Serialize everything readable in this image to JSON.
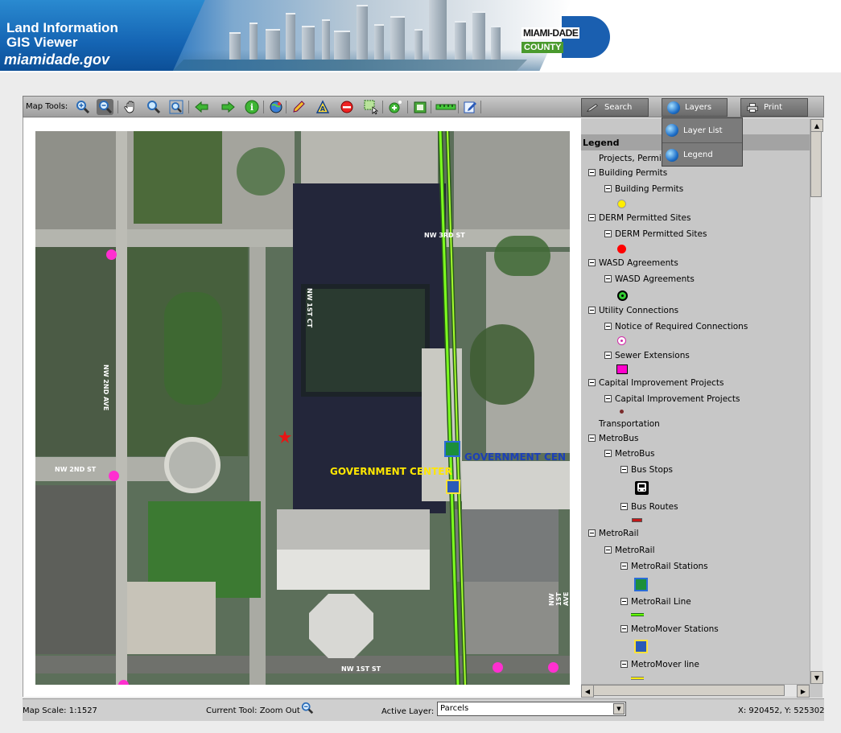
{
  "banner": {
    "title_line1": "Land Information",
    "title_line2": "GIS Viewer",
    "url": "miamidade.gov",
    "logo_name": "MIAMI-DADE",
    "logo_sub": "COUNTY"
  },
  "toolbar": {
    "label": "Map Tools:",
    "tools": [
      "zoom-in-icon",
      "zoom-out-icon",
      "pan-hand-icon",
      "zoom-full-icon",
      "zoom-extent-icon",
      "back-icon",
      "forward-icon",
      "identify-icon",
      "globe-icon",
      "pencil-icon",
      "text-icon",
      "erase-icon",
      "select-box-icon",
      "add-point-icon",
      "clear-icon",
      "measure-icon",
      "edit-icon"
    ],
    "active_tool": "zoom-out-icon"
  },
  "tabs": {
    "search": "Search",
    "layers": "Layers",
    "print": "Print"
  },
  "layers_menu": {
    "items": [
      "Layer List",
      "Legend"
    ]
  },
  "map": {
    "labels": {
      "street_3rd": "NW 3RD ST",
      "street_1st_ct": "NW 1ST CT",
      "ave_2nd": "NW 2ND AVE",
      "street_2nd": "NW 2ND ST",
      "gov_center": "GOVERNMENT CENTER",
      "gov_center_2": "GOVERNMENT CEN",
      "street_1st": "NW 1ST ST",
      "ave_1st": "NW 1ST AVE"
    }
  },
  "legend": {
    "header": "Legend",
    "rows": [
      {
        "text": "Projects, Permits",
        "indent": 0,
        "toggle": false
      },
      {
        "text": "Building Permits",
        "indent": 0,
        "toggle": true
      },
      {
        "text": "Building Permits",
        "indent": 1,
        "toggle": true
      },
      {
        "text": "DERM Permitted Sites",
        "indent": 0,
        "toggle": true
      },
      {
        "text": "DERM Permitted Sites",
        "indent": 1,
        "toggle": true
      },
      {
        "text": "WASD Agreements",
        "indent": 0,
        "toggle": true
      },
      {
        "text": "WASD Agreements",
        "indent": 1,
        "toggle": true
      },
      {
        "text": "Utility Connections",
        "indent": 0,
        "toggle": true
      },
      {
        "text": "Notice of Required Connections",
        "indent": 1,
        "toggle": true
      },
      {
        "text": "Sewer Extensions",
        "indent": 1,
        "toggle": true
      },
      {
        "text": "Capital Improvement Projects",
        "indent": 0,
        "toggle": true
      },
      {
        "text": "Capital Improvement Projects",
        "indent": 1,
        "toggle": true
      },
      {
        "text": "Transportation",
        "indent": 0,
        "toggle": false
      },
      {
        "text": "MetroBus",
        "indent": 0,
        "toggle": true
      },
      {
        "text": "MetroBus",
        "indent": 1,
        "toggle": true
      },
      {
        "text": "Bus Stops",
        "indent": 2,
        "toggle": true
      },
      {
        "text": "Bus Routes",
        "indent": 2,
        "toggle": true
      },
      {
        "text": "MetroRail",
        "indent": 0,
        "toggle": true
      },
      {
        "text": "MetroRail",
        "indent": 1,
        "toggle": true
      },
      {
        "text": "MetroRail Stations",
        "indent": 2,
        "toggle": true
      },
      {
        "text": "MetroRail Line",
        "indent": 2,
        "toggle": true
      },
      {
        "text": "MetroMover Stations",
        "indent": 2,
        "toggle": true
      },
      {
        "text": "MetroMover line",
        "indent": 2,
        "toggle": true
      }
    ],
    "colors": {
      "building_permit": "#ffee00",
      "derm_site": "#ff0000",
      "wasd": "#33cc33",
      "sewer": "#ff00cc",
      "metrorail_line": "#66ff00",
      "metromover_line": "#ffee00"
    }
  },
  "status": {
    "scale": "Map Scale: 1:1527",
    "current_tool": "Current Tool: Zoom Out",
    "active_layer_label": "Active Layer:",
    "active_layer_value": "Parcels",
    "coords": "X: 920452, Y: 525302"
  }
}
